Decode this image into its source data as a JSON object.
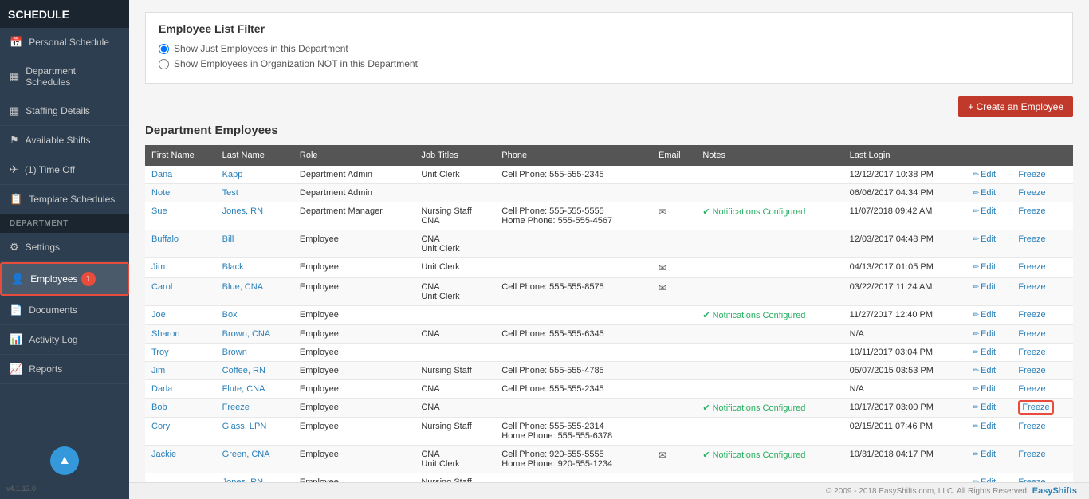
{
  "sidebar": {
    "logo": "SCHEDULE",
    "version": "v4.1.13.0",
    "items": [
      {
        "id": "personal-schedule",
        "label": "Personal Schedule",
        "icon": "📅",
        "active": false
      },
      {
        "id": "department-schedules",
        "label": "Department Schedules",
        "icon": "▦",
        "active": false
      },
      {
        "id": "staffing-details",
        "label": "Staffing Details",
        "icon": "▦",
        "active": false
      },
      {
        "id": "available-shifts",
        "label": "Available Shifts",
        "icon": "⚑",
        "active": false
      },
      {
        "id": "time-off",
        "label": "(1) Time Off",
        "icon": "✈",
        "active": false
      },
      {
        "id": "template-schedules",
        "label": "Template Schedules",
        "icon": "📋",
        "active": false
      }
    ],
    "department_section": "DEPARTMENT",
    "department_items": [
      {
        "id": "settings",
        "label": "Settings",
        "icon": "⚙"
      },
      {
        "id": "employees",
        "label": "Employees",
        "icon": "👤",
        "active": true
      },
      {
        "id": "documents",
        "label": "Documents",
        "icon": "📄"
      },
      {
        "id": "activity-log",
        "label": "Activity Log",
        "icon": "📊"
      },
      {
        "id": "reports",
        "label": "Reports",
        "icon": "📈"
      }
    ]
  },
  "filter": {
    "title": "Employee List Filter",
    "option1": "Show Just Employees in this Department",
    "option2": "Show Employees in Organization NOT in this Department"
  },
  "employees_section": {
    "title": "Department Employees",
    "create_button": "+ Create an Employee"
  },
  "table": {
    "headers": [
      "First Name",
      "Last Name",
      "Role",
      "Job Titles",
      "Phone",
      "Email",
      "Notes",
      "Last Login",
      "",
      ""
    ],
    "rows": [
      {
        "first_name": "Dana",
        "last_name": "Kapp",
        "role": "Department Admin",
        "job_titles": "Unit Clerk",
        "phone": "Cell Phone: 555-555-2345",
        "email": "",
        "notes": "",
        "last_login": "12/12/2017 10:38 PM",
        "edit": "Edit",
        "freeze": "Freeze",
        "highlight_freeze": false
      },
      {
        "first_name": "Note",
        "last_name": "Test",
        "role": "Department Admin",
        "job_titles": "",
        "phone": "",
        "email": "",
        "notes": "",
        "last_login": "06/06/2017 04:34 PM",
        "edit": "Edit",
        "freeze": "Freeze",
        "highlight_freeze": false
      },
      {
        "first_name": "Sue",
        "last_name": "Jones, RN",
        "role": "Department Manager",
        "job_titles": "Nursing Staff\nCNA",
        "phone": "Cell Phone: 555-555-5555\nHome Phone: 555-555-4567",
        "email": "✉",
        "notes": "✔ Notifications Configured",
        "last_login": "11/07/2018 09:42 AM",
        "edit": "Edit",
        "freeze": "Freeze",
        "highlight_freeze": false
      },
      {
        "first_name": "Buffalo",
        "last_name": "Bill",
        "role": "Employee",
        "job_titles": "CNA\nUnit Clerk",
        "phone": "",
        "email": "",
        "notes": "",
        "last_login": "12/03/2017 04:48 PM",
        "edit": "Edit",
        "freeze": "Freeze",
        "highlight_freeze": false
      },
      {
        "first_name": "Jim",
        "last_name": "Black",
        "role": "Employee",
        "job_titles": "Unit Clerk",
        "phone": "",
        "email": "✉",
        "notes": "",
        "last_login": "04/13/2017 01:05 PM",
        "edit": "Edit",
        "freeze": "Freeze",
        "highlight_freeze": false
      },
      {
        "first_name": "Carol",
        "last_name": "Blue, CNA",
        "role": "Employee",
        "job_titles": "CNA\nUnit Clerk",
        "phone": "Cell Phone: 555-555-8575",
        "email": "✉",
        "notes": "",
        "last_login": "03/22/2017 11:24 AM",
        "edit": "Edit",
        "freeze": "Freeze",
        "highlight_freeze": false
      },
      {
        "first_name": "Joe",
        "last_name": "Box",
        "role": "Employee",
        "job_titles": "",
        "phone": "",
        "email": "",
        "notes": "✔ Notifications Configured",
        "last_login": "11/27/2017 12:40 PM",
        "edit": "Edit",
        "freeze": "Freeze",
        "highlight_freeze": false
      },
      {
        "first_name": "Sharon",
        "last_name": "Brown, CNA",
        "role": "Employee",
        "job_titles": "CNA",
        "phone": "Cell Phone: 555-555-6345",
        "email": "",
        "notes": "",
        "last_login": "N/A",
        "edit": "Edit",
        "freeze": "Freeze",
        "highlight_freeze": false
      },
      {
        "first_name": "Troy",
        "last_name": "Brown",
        "role": "Employee",
        "job_titles": "",
        "phone": "",
        "email": "",
        "notes": "",
        "last_login": "10/11/2017 03:04 PM",
        "edit": "Edit",
        "freeze": "Freeze",
        "highlight_freeze": false
      },
      {
        "first_name": "Jim",
        "last_name": "Coffee, RN",
        "role": "Employee",
        "job_titles": "Nursing Staff",
        "phone": "Cell Phone: 555-555-4785",
        "email": "",
        "notes": "",
        "last_login": "05/07/2015 03:53 PM",
        "edit": "Edit",
        "freeze": "Freeze",
        "highlight_freeze": false
      },
      {
        "first_name": "Darla",
        "last_name": "Flute, CNA",
        "role": "Employee",
        "job_titles": "CNA",
        "phone": "Cell Phone: 555-555-2345",
        "email": "",
        "notes": "",
        "last_login": "N/A",
        "edit": "Edit",
        "freeze": "Freeze",
        "highlight_freeze": false
      },
      {
        "first_name": "Bob",
        "last_name": "Freeze",
        "role": "Employee",
        "job_titles": "CNA",
        "phone": "",
        "email": "",
        "notes": "✔ Notifications Configured",
        "last_login": "10/17/2017 03:00 PM",
        "edit": "Edit",
        "freeze": "Freeze",
        "highlight_freeze": true
      },
      {
        "first_name": "Cory",
        "last_name": "Glass, LPN",
        "role": "Employee",
        "job_titles": "Nursing Staff",
        "phone": "Cell Phone: 555-555-2314\nHome Phone: 555-555-6378",
        "email": "",
        "notes": "",
        "last_login": "02/15/2011 07:46 PM",
        "edit": "Edit",
        "freeze": "Freeze",
        "highlight_freeze": false
      },
      {
        "first_name": "Jackie",
        "last_name": "Green, CNA",
        "role": "Employee",
        "job_titles": "CNA\nUnit Clerk",
        "phone": "Cell Phone: 920-555-5555\nHome Phone: 920-555-1234",
        "email": "✉",
        "notes": "✔ Notifications Configured",
        "last_login": "10/31/2018 04:17 PM",
        "edit": "Edit",
        "freeze": "Freeze",
        "highlight_freeze": false
      },
      {
        "first_name": "...",
        "last_name": "Jones, RN",
        "role": "Employee",
        "job_titles": "Nursing Staff",
        "phone": "...",
        "email": "",
        "notes": "",
        "last_login": "...",
        "edit": "Edit",
        "freeze": "Freeze",
        "highlight_freeze": false
      }
    ]
  },
  "footer": {
    "copyright": "© 2009 - 2018 EasyShifts.com, LLC. All Rights Reserved.",
    "brand": "EasyShifts"
  }
}
